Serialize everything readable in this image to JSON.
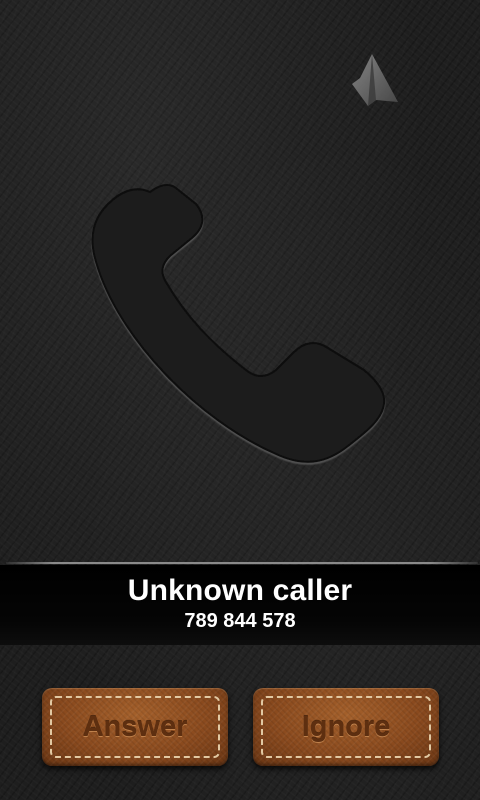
{
  "caller": {
    "name": "Unknown caller",
    "number": "789 844 578"
  },
  "actions": {
    "answer_label": "Answer",
    "ignore_label": "Ignore"
  },
  "icons": {
    "speaker": "speaker-icon",
    "handset": "phone-handset-icon"
  },
  "colors": {
    "background": "#1e1e1e",
    "caller_bar": "#000000",
    "caller_text": "#ffffff",
    "leather": "#8a4a1e",
    "stitch": "#e2c9a3",
    "button_text": "#5e2f10"
  }
}
